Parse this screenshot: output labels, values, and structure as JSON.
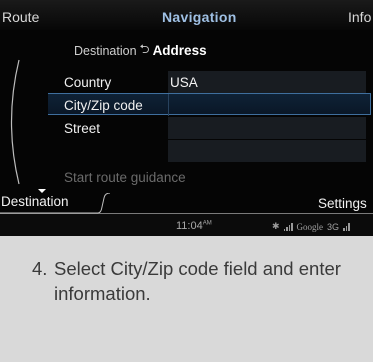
{
  "top_tabs": {
    "left": "Route",
    "center": "Navigation",
    "right": "Info"
  },
  "breadcrumb": {
    "parent": "Destination",
    "arrow": "⮌",
    "current": "Address"
  },
  "rows": [
    {
      "label": "Country",
      "value": "USA"
    },
    {
      "label": "City/Zip code",
      "value": ""
    },
    {
      "label": "Street",
      "value": ""
    }
  ],
  "guidance": "Start route guidance",
  "bottom_tabs": {
    "left": "Destination",
    "right": "Settings"
  },
  "status": {
    "time": "11:04",
    "time_suffix": "AM",
    "google": "Google",
    "network": "3G"
  },
  "caption": {
    "number": "4.",
    "text": "Select City/Zip code field and enter information."
  },
  "colors": {
    "accent": "#9fc0e4",
    "selected_border": "#3f6f9e",
    "background": "#d9d9d9"
  }
}
